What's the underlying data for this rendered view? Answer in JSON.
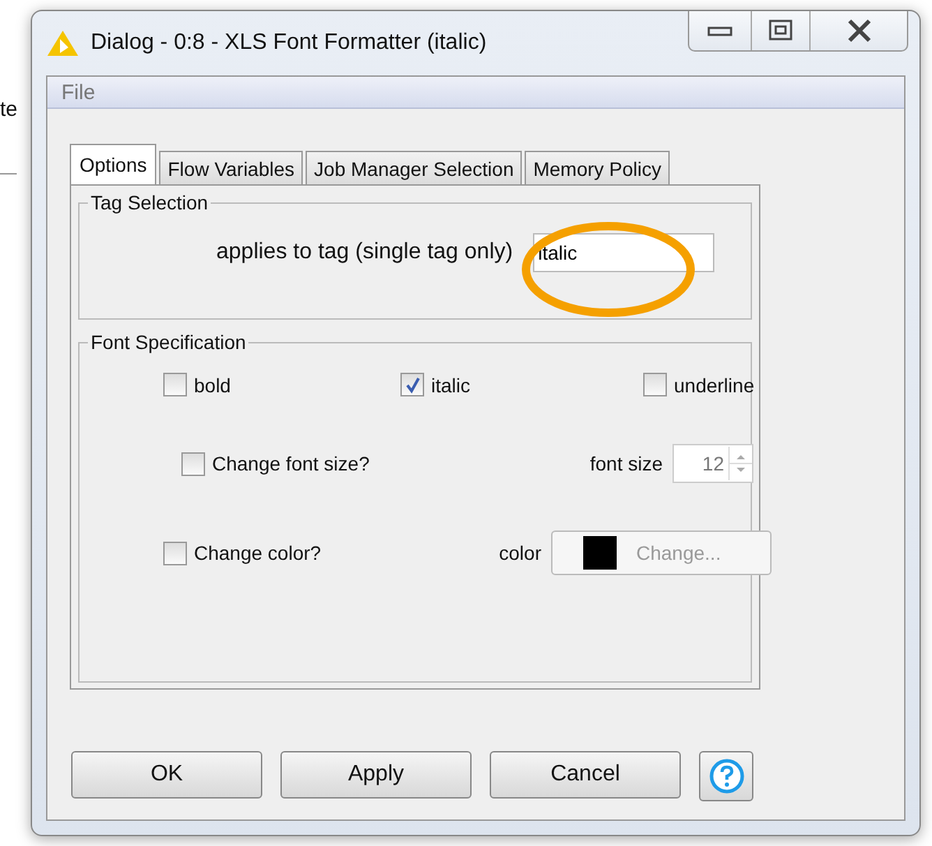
{
  "background_text": "te",
  "window": {
    "title": "Dialog - 0:8 - XLS Font Formatter (italic)"
  },
  "menu": [
    "File"
  ],
  "tabs": [
    {
      "label": "Options",
      "selected": true
    },
    {
      "label": "Flow Variables",
      "selected": false
    },
    {
      "label": "Job Manager Selection",
      "selected": false
    },
    {
      "label": "Memory Policy",
      "selected": false
    }
  ],
  "tag_selection": {
    "legend": "Tag Selection",
    "label": "applies to tag (single tag only)",
    "value": "italic"
  },
  "font_specification": {
    "legend": "Font Specification",
    "styles": [
      {
        "label": "bold",
        "checked": false
      },
      {
        "label": "italic",
        "checked": true
      },
      {
        "label": "underline",
        "checked": false
      }
    ],
    "font_size": {
      "checkbox_label": "Change font size?",
      "checked": false,
      "label": "font size",
      "value": "12",
      "disabled": true
    },
    "color": {
      "checkbox_label": "Change color?",
      "checked": false,
      "label": "color",
      "button_label": "Change...",
      "disabled": true
    }
  },
  "buttons": [
    "OK",
    "Apply",
    "Cancel"
  ]
}
